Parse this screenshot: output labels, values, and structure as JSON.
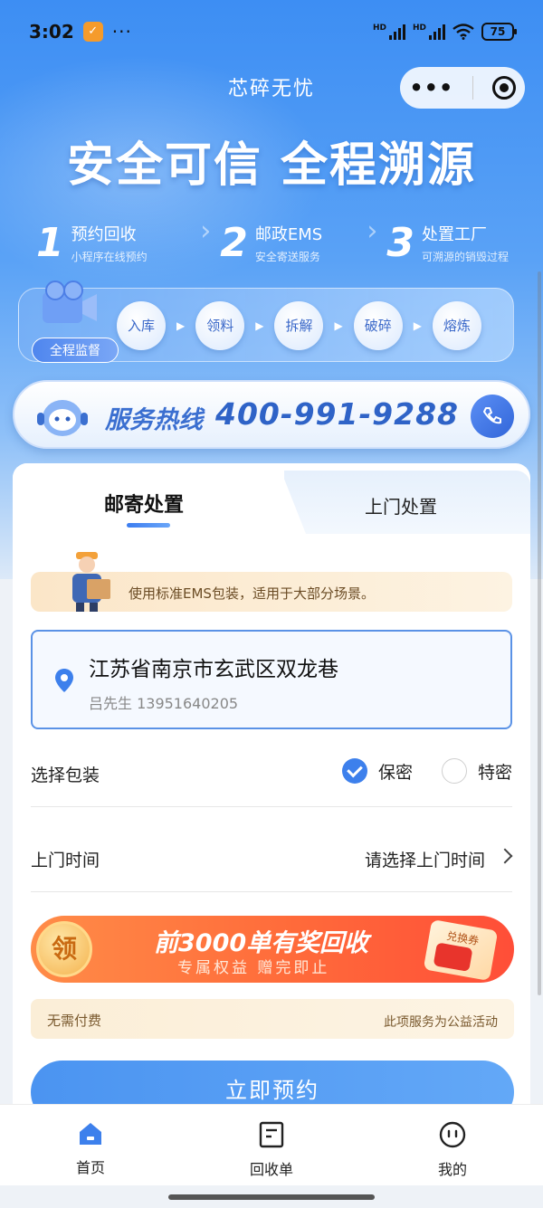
{
  "status_bar": {
    "time": "3:02",
    "more": "···",
    "signal_label": "HD",
    "battery": "75"
  },
  "header": {
    "title": "芯碎无忧",
    "capsule_more": "•••"
  },
  "hero": {
    "slogan": "安全可信 全程溯源",
    "steps": [
      {
        "num": "1",
        "title": "预约回收",
        "sub": "小程序在线预约"
      },
      {
        "num": "2",
        "title": "邮政EMS",
        "sub": "安全寄送服务"
      },
      {
        "num": "3",
        "title": "处置工厂",
        "sub": "可溯源的销毁过程"
      }
    ],
    "monitor_badge": "全程监督",
    "process": [
      "入库",
      "领料",
      "拆解",
      "破碎",
      "熔炼"
    ]
  },
  "hotline": {
    "label": "服务热线",
    "number": "400-991-9288"
  },
  "tabs": {
    "active": "邮寄处置",
    "inactive": "上门处置"
  },
  "notice": {
    "text": "使用标准EMS包装，适用于大部分场景。"
  },
  "address": {
    "main": "江苏省南京市玄武区双龙巷",
    "contact": "吕先生 13951640205"
  },
  "packaging": {
    "label": "选择包装",
    "options": [
      {
        "label": "保密",
        "selected": true
      },
      {
        "label": "特密",
        "selected": false
      }
    ]
  },
  "visit_time": {
    "label": "上门时间",
    "placeholder": "请选择上门时间"
  },
  "promo": {
    "coin": "领",
    "title": "前3000单有奖回收",
    "subtitle": "专属权益 赠完即止",
    "coupon": "兑换券"
  },
  "fee": {
    "left": "无需付费",
    "right": "此项服务为公益活动"
  },
  "submit_label": "立即预约",
  "tabbar": [
    {
      "label": "首页",
      "icon": "home-icon",
      "active": true
    },
    {
      "label": "回收单",
      "icon": "document-icon",
      "active": false
    },
    {
      "label": "我的",
      "icon": "face-icon",
      "active": false
    }
  ],
  "colors": {
    "primary": "#3d80ec",
    "accent_orange": "#ff6a3a",
    "notice_bg": "#fbe6c8"
  }
}
